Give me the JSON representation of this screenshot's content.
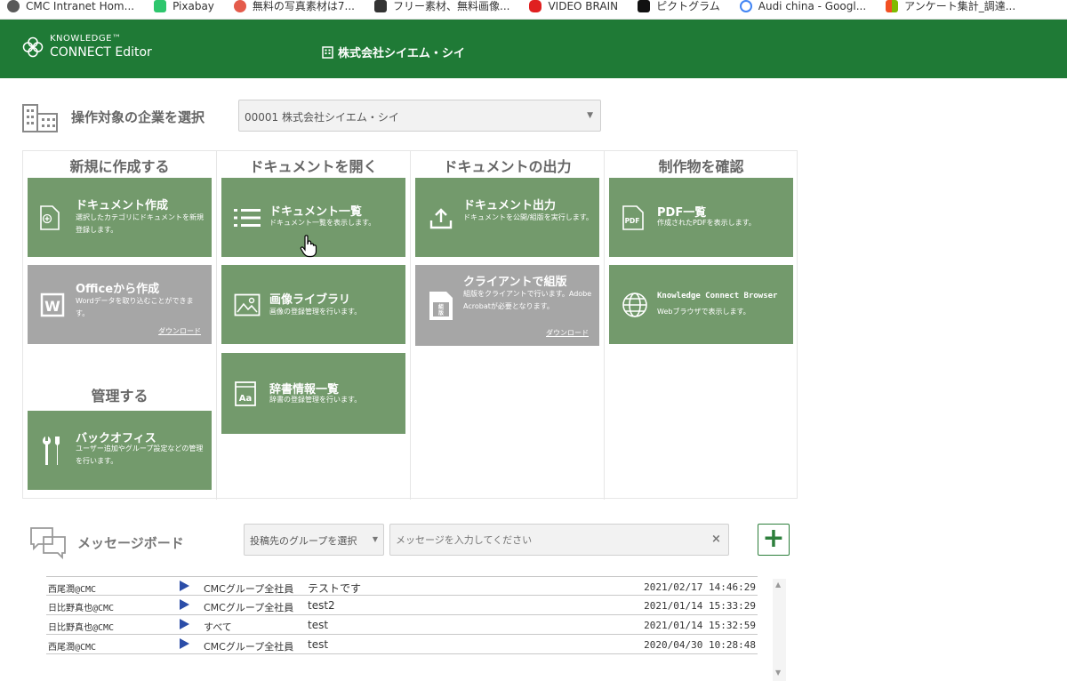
{
  "browser": {
    "bookmarks": [
      {
        "label": "CMC Intranet Hom...",
        "color": "#5a5a5a"
      },
      {
        "label": "Pixabay",
        "color": "#2ec66d"
      },
      {
        "label": "無料の写真素材は7...",
        "color": "#e45b4b"
      },
      {
        "label": "フリー素材、無料画像...",
        "color": "#333333"
      },
      {
        "label": "VIDEO BRAIN",
        "color": "#e02020"
      },
      {
        "label": "ピクトグラム",
        "color": "#111111"
      },
      {
        "label": "Audi china - Googl...",
        "color": "#4285f4"
      },
      {
        "label": "アンケート集計_調達...",
        "color": "#f4b400"
      }
    ]
  },
  "header": {
    "logo_line1": "KNOWLEDGE™",
    "logo_line2": "CONNECT Editor",
    "company_title": "株式会社シイエム・シイ",
    "bg_color": "#1f7a36"
  },
  "company_selector": {
    "label": "操作対象の企業を選択",
    "value": "00001 株式会社シイエム・シイ"
  },
  "columns": {
    "create": "新規に作成する",
    "open": "ドキュメントを開く",
    "output": "ドキュメントの出力",
    "check": "制作物を確認",
    "manage": "管理する"
  },
  "tiles": {
    "doc_create": {
      "title": "ドキュメント作成",
      "desc": "選択したカテゴリにドキュメントを新規登録します。"
    },
    "office_create": {
      "title": "Officeから作成",
      "desc": "Wordデータを取り込むことができます。",
      "link": "ダウンロード"
    },
    "back_office": {
      "title": "バックオフィス",
      "desc": "ユーザー追加やグループ設定などの管理を行います。"
    },
    "doc_list": {
      "title": "ドキュメント一覧",
      "desc": "ドキュメント一覧を表示します。"
    },
    "image_library": {
      "title": "画像ライブラリ",
      "desc": "画像の登録管理を行います。"
    },
    "dictionary": {
      "title": "辞書情報一覧",
      "desc": "辞書の登録管理を行います。"
    },
    "doc_output": {
      "title": "ドキュメント出力",
      "desc": "ドキュメントを公開/組版を実行します。"
    },
    "client_typeset": {
      "title": "クライアントで組版",
      "desc": "組版をクライアントで行います。Adobe Acrobatが必要となります。",
      "link": "ダウンロード"
    },
    "pdf_list": {
      "title": "PDF一覧",
      "desc": "作成されたPDFを表示します。"
    },
    "browser": {
      "title": "Knowledge Connect Browser",
      "desc": "Webブラウザで表示します。"
    }
  },
  "tile_colors": {
    "green": "#739a6c",
    "gray": "#a6a6a6"
  },
  "message_board": {
    "label": "メッセージボード",
    "group_placeholder": "投稿先のグループを選択",
    "message_placeholder": "メッセージを入力してください",
    "clear_symbol": "×",
    "add_symbol": "+",
    "messages": [
      {
        "user": "西尾潤@CMC",
        "group": "CMCグループ全社員",
        "text": "テストです",
        "time": "2021/02/17 14:46:29"
      },
      {
        "user": "日比野真也@CMC",
        "group": "CMCグループ全社員",
        "text": "test2",
        "time": "2021/01/14 15:33:29"
      },
      {
        "user": "日比野真也@CMC",
        "group": "すべて",
        "text": "test",
        "time": "2021/01/14 15:32:59"
      },
      {
        "user": "西尾潤@CMC",
        "group": "CMCグループ全社員",
        "text": "test",
        "time": "2020/04/30 10:28:48"
      }
    ]
  }
}
